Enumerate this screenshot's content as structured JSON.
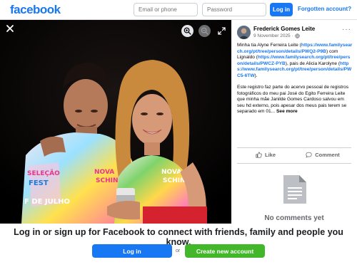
{
  "header": {
    "logo": "facebook",
    "email_placeholder": "Email or phone",
    "password_placeholder": "Password",
    "login_label": "Log in",
    "forgot_label": "Forgotten account?"
  },
  "post": {
    "author": "Frederick Gomes Leite",
    "date": "9 November 2025",
    "intro": "Minha tia Alyne Ferreira Leite (",
    "link1": "https://www.familysearch.org/pt/tree/person/details/PWQ2-P9B",
    "mid1": ") com Lignaldo (",
    "link2": "https://www.familysearch.org/pt/tree/person/details/PWCZ-PYB",
    "mid2": "), pais de Alicia Karolyne (",
    "link3": "https://www.familysearch.org/pt/tree/person/details/PWC5-6TW",
    "end1": ").",
    "paragraph2": "Este registro faz parte do acervo pessoal de registros fotográficos do meu pai José do Egito Ferreira Leite que minha mãe Janilde Gomes Cardoso salvou em seu hd externo, pois apesar dos meus pais terem se separado em 01...",
    "see_more": "See more",
    "like_label": "Like",
    "comment_label": "Comment",
    "no_comments": "No comments yet"
  },
  "banner": {
    "text": "Log in or sign up for Facebook to connect with friends, family and people you know.",
    "login_label": "Log in",
    "or_label": "or",
    "create_label": "Create new account"
  },
  "icons": {
    "close": "close-icon",
    "zoom_in": "zoom-in-icon",
    "zoom_out": "zoom-out-icon",
    "expand": "expand-icon",
    "globe": "globe-icon",
    "like": "thumbs-up-icon",
    "comment": "comment-icon",
    "document": "document-icon"
  },
  "colors": {
    "brand": "#1877f2",
    "create": "#42b72a",
    "secondary_text": "#65676b"
  }
}
